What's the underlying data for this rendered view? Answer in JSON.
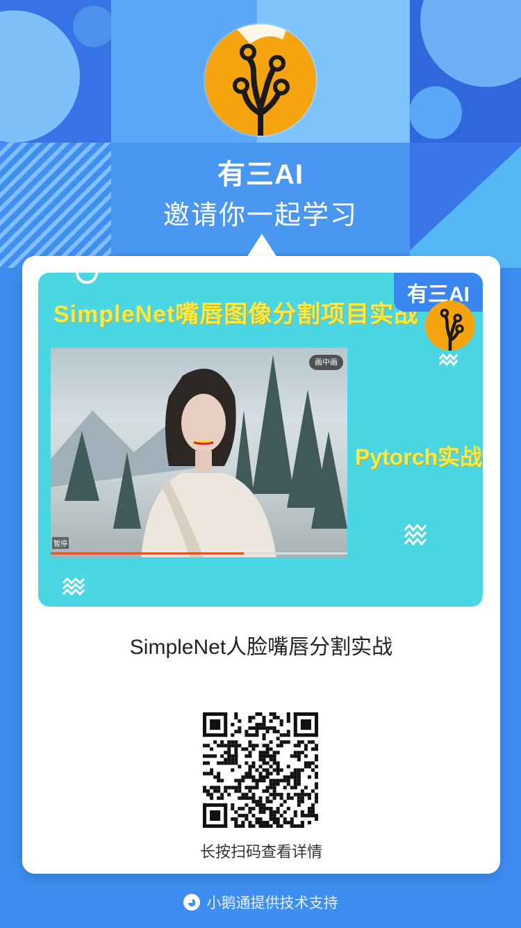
{
  "header": {
    "brand_name": "有三AI",
    "invite_text": "邀请你一起学习"
  },
  "cover": {
    "title": "SimpleNet嘴唇图像分割项目实战",
    "badge": "有三AI",
    "subtitle": "Pytorch实战",
    "video": {
      "corner_tag": "画中画",
      "pause_label": "暂停",
      "progress": 0.65
    }
  },
  "course": {
    "title": "SimpleNet人脸嘴唇分割实战"
  },
  "qr": {
    "caption": "长按扫码查看详情"
  },
  "footer": {
    "text": "小鹅通提供技术支持",
    "icon": "goose-logo-icon"
  },
  "colors": {
    "background": "#3d8ef0",
    "accent_orange": "#f5a30f",
    "cover_cyan": "#4bd6e3",
    "cover_title_yellow": "#f5ea4a",
    "badge_blue": "#3a86f0"
  }
}
